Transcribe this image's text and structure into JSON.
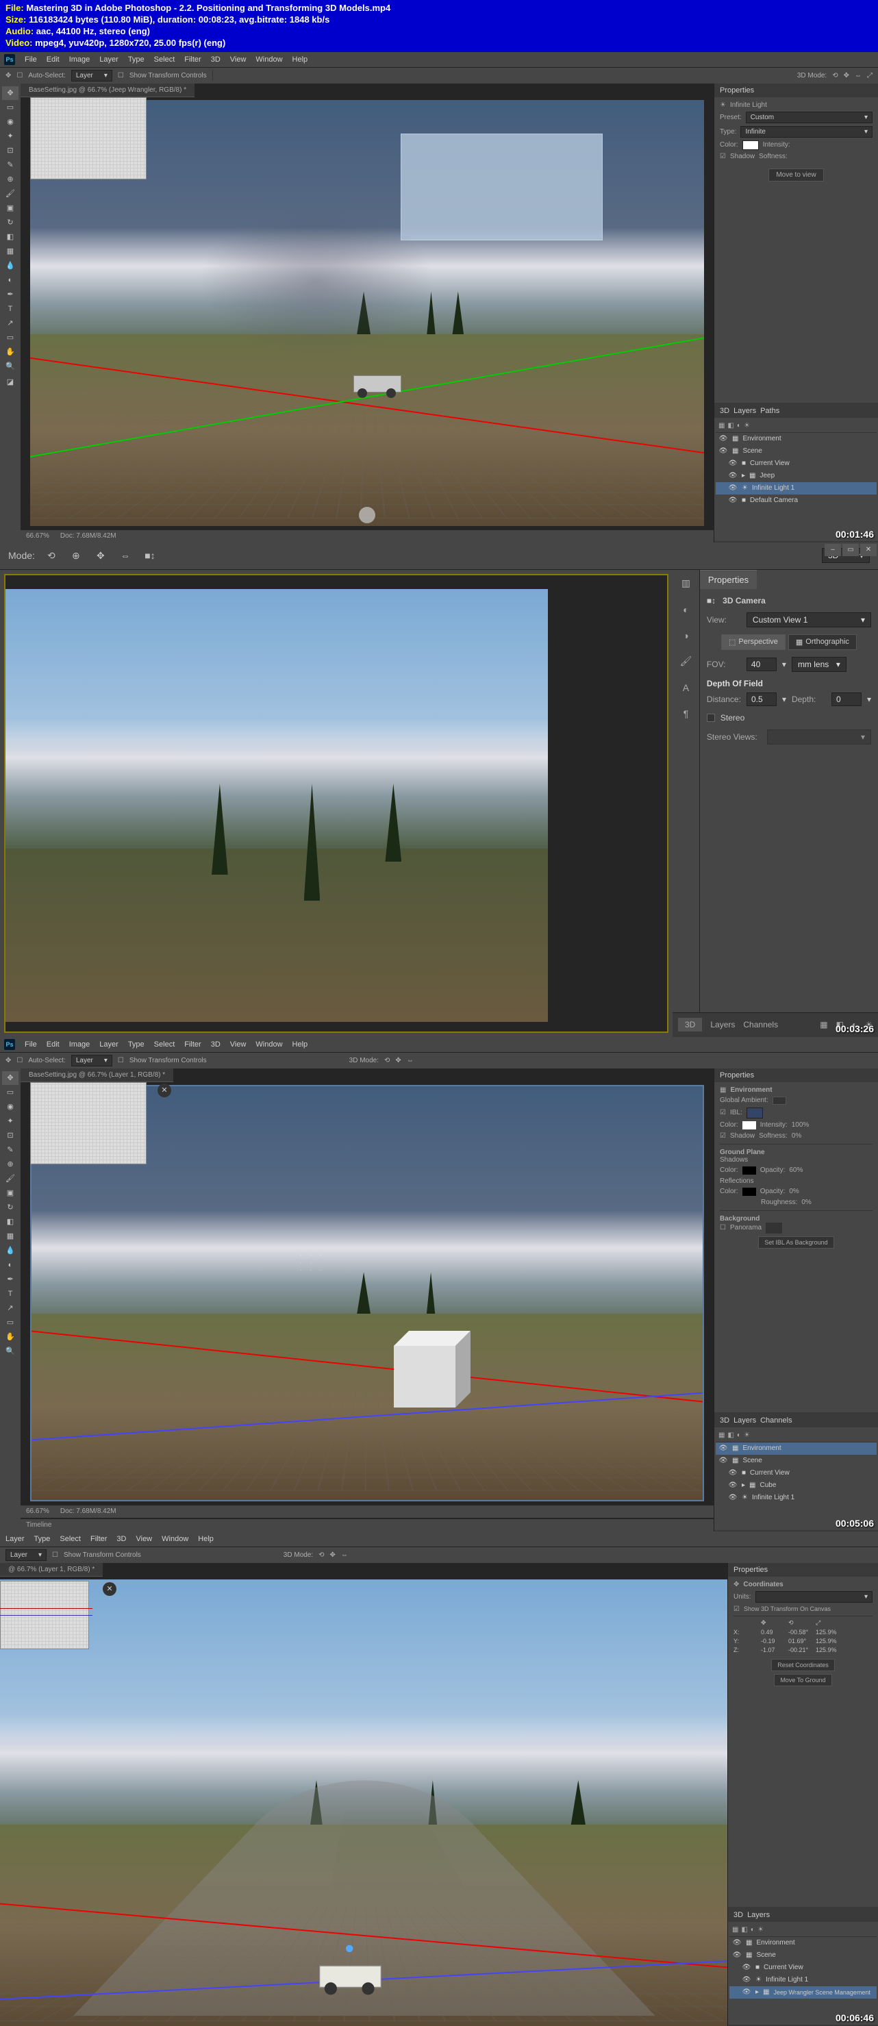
{
  "file_info": {
    "file_label": "File:",
    "file_name": "Mastering 3D in Adobe Photoshop - 2.2. Positioning and Transforming 3D Models.mp4",
    "size_label": "Size:",
    "size_value": "116183424 bytes (110.80 MiB), duration: 00:08:23, avg.bitrate: 1848 kb/s",
    "audio_label": "Audio:",
    "audio_value": "aac, 44100 Hz, stereo (eng)",
    "video_label": "Video:",
    "video_value": "mpeg4, yuv420p, 1280x720, 25.00 fps(r) (eng)"
  },
  "timestamps": {
    "t1": "00:01:46",
    "t2": "00:03:26",
    "t3": "00:05:06",
    "t4": "00:06:46"
  },
  "menu": {
    "ps": "Ps",
    "file": "File",
    "edit": "Edit",
    "image": "Image",
    "layer": "Layer",
    "type": "Type",
    "select": "Select",
    "filter": "Filter",
    "threeD": "3D",
    "view": "View",
    "window": "Window",
    "help": "Help"
  },
  "optbar": {
    "auto_select": "Auto-Select:",
    "layer": "Layer",
    "show_transform": "Show Transform Controls",
    "mode3d": "3D Mode:"
  },
  "doc_tab": {
    "f1": "BaseSetting.jpg @ 66.7% (Jeep Wrangler, RGB/8) *",
    "f3": "BaseSetting.jpg @ 66.7% (Layer 1, RGB/8) *",
    "f4": "@ 66.7% (Layer 1, RGB/8) *"
  },
  "status": {
    "zoom": "66.67%",
    "doc": "Doc: 7.68M/8.42M"
  },
  "f2": {
    "mode": "Mode:",
    "dropdown_3d": "3D",
    "props_tab": "Properties",
    "camera_title": "3D Camera",
    "view_label": "View:",
    "view_value": "Custom View 1",
    "perspective": "Perspective",
    "orthographic": "Orthographic",
    "fov_label": "FOV:",
    "fov_value": "40",
    "fov_unit": "mm lens",
    "dof_label": "Depth Of Field",
    "distance_label": "Distance:",
    "distance_value": "0.5",
    "depth_label": "Depth:",
    "depth_value": "0",
    "stereo": "Stereo",
    "stereo_views": "Stereo Views:",
    "tabs": {
      "threeD": "3D",
      "layers": "Layers",
      "channels": "Channels"
    }
  },
  "f3_panels": {
    "properties": "Properties",
    "environment": "Environment",
    "global_ambient": "Global Ambient:",
    "ibl": "IBL:",
    "color": "Color:",
    "intensity": "Intensity:",
    "intensity_val": "100%",
    "shadow": "Shadow",
    "softness": "Softness:",
    "softness_val": "0%",
    "ground_plane": "Ground Plane",
    "shadows": "Shadows",
    "reflections": "Reflections",
    "opacity": "Opacity:",
    "opacity_val": "60%",
    "roughness": "Roughness:",
    "roughness_val": "0%",
    "background": "Background",
    "panorama": "Panorama",
    "set_ibl_btn": "Set IBL As Background",
    "layers_tab_3d": "3D",
    "layers_tab_layers": "Layers",
    "layers_tab_channels": "Channels",
    "layer_env": "Environment",
    "layer_scene": "Scene",
    "layer_view": "Current View",
    "layer_cube": "Cube",
    "layer_light": "Infinite Light 1"
  },
  "f4_panels": {
    "properties": "Properties",
    "coordinates": "Coordinates",
    "units": "Units:",
    "show_transform": "Show 3D Transform On Canvas",
    "x": "X:",
    "y": "Y:",
    "z": "Z:",
    "x_val": "0.49",
    "x_rot": "-00.58°",
    "x_scale": "125.9%",
    "y_val": "-0.19",
    "y_rot": "01.69°",
    "y_scale": "125.9%",
    "z_val": "-1.07",
    "z_rot": "-00.21°",
    "z_scale": "125.9%",
    "reset_coords": "Reset Coordinates",
    "move_to_ground": "Move To Ground",
    "layer_env": "Environment",
    "layer_scene": "Scene",
    "layer_view": "Current View",
    "layer_light": "Infinite Light 1",
    "layer_jeep": "Jeep Wrangler Scene Management"
  },
  "f1_layers": {
    "tab_3d": "3D",
    "tab_layers": "Layers",
    "tab_paths": "Paths",
    "env": "Environment",
    "scene": "Scene",
    "current_view": "Current View",
    "jeep": "Jeep",
    "light": "Infinite Light 1",
    "camera": "Default Camera"
  },
  "f1_props": {
    "tab": "Properties",
    "title": "Infinite Light",
    "preset": "Preset:",
    "custom": "Custom",
    "type": "Type:",
    "infinite": "Infinite",
    "color": "Color:",
    "intensity": "Intensity:",
    "shadow": "Shadow",
    "softness": "Softness:",
    "move_to_view": "Move to view"
  },
  "timeline": "Timeline"
}
